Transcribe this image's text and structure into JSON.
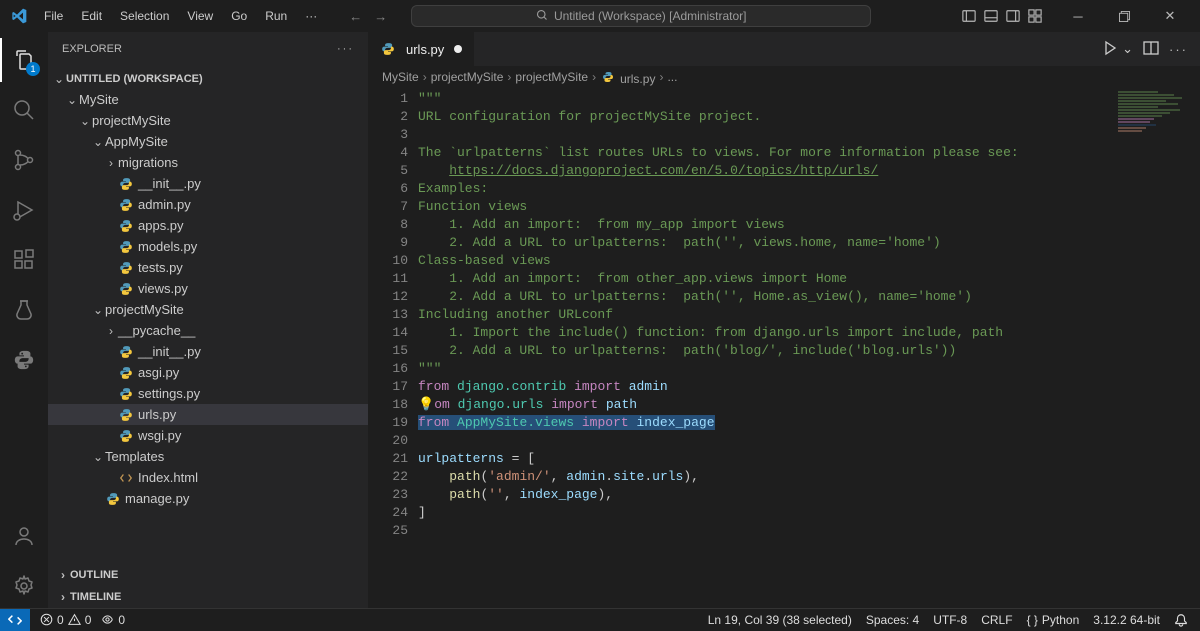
{
  "titlebar": {
    "menu": [
      "File",
      "Edit",
      "Selection",
      "View",
      "Go",
      "Run",
      "···"
    ],
    "search_placeholder": "Untitled (Workspace) [Administrator]"
  },
  "activity": {
    "explorer_badge": "1"
  },
  "sidebar": {
    "title": "EXPLORER",
    "workspace_label": "UNTITLED (WORKSPACE)",
    "outline_label": "OUTLINE",
    "timeline_label": "TIMELINE",
    "tree": [
      {
        "depth": 1,
        "twist": "v",
        "label": "MySite",
        "type": "folder"
      },
      {
        "depth": 2,
        "twist": "v",
        "label": "projectMySite",
        "type": "folder"
      },
      {
        "depth": 3,
        "twist": "v",
        "label": "AppMySite",
        "type": "folder"
      },
      {
        "depth": 4,
        "twist": ">",
        "label": "migrations",
        "type": "folder"
      },
      {
        "depth": 4,
        "icon": "py",
        "label": "__init__.py"
      },
      {
        "depth": 4,
        "icon": "py",
        "label": "admin.py"
      },
      {
        "depth": 4,
        "icon": "py",
        "label": "apps.py"
      },
      {
        "depth": 4,
        "icon": "py",
        "label": "models.py"
      },
      {
        "depth": 4,
        "icon": "py",
        "label": "tests.py"
      },
      {
        "depth": 4,
        "icon": "py",
        "label": "views.py"
      },
      {
        "depth": 3,
        "twist": "v",
        "label": "projectMySite",
        "type": "folder"
      },
      {
        "depth": 4,
        "twist": ">",
        "label": "__pycache__",
        "type": "folder"
      },
      {
        "depth": 4,
        "icon": "py",
        "label": "__init__.py"
      },
      {
        "depth": 4,
        "icon": "py",
        "label": "asgi.py"
      },
      {
        "depth": 4,
        "icon": "py",
        "label": "settings.py"
      },
      {
        "depth": 4,
        "icon": "py",
        "label": "urls.py",
        "selected": true
      },
      {
        "depth": 4,
        "icon": "py",
        "label": "wsgi.py"
      },
      {
        "depth": 3,
        "twist": "v",
        "label": "Templates",
        "type": "folder"
      },
      {
        "depth": 4,
        "icon": "html",
        "label": "Index.html"
      },
      {
        "depth": 3,
        "icon": "py",
        "label": "manage.py"
      }
    ]
  },
  "tab": {
    "filename": "urls.py",
    "modified": true
  },
  "breadcrumbs": [
    "MySite",
    "projectMySite",
    "projectMySite",
    "urls.py",
    "..."
  ],
  "editor": {
    "lines": [
      {
        "n": 1,
        "html": "<span class='c-comment'>\"\"\"</span>"
      },
      {
        "n": 2,
        "html": "<span class='c-comment'>URL configuration for projectMySite project.</span>"
      },
      {
        "n": 3,
        "html": ""
      },
      {
        "n": 4,
        "html": "<span class='c-comment'>The `urlpatterns` list routes URLs to views. For more information please see:</span>"
      },
      {
        "n": 5,
        "html": "<span class='c-comment'>    </span><span class='c-url'>https://docs.djangoproject.com/en/5.0/topics/http/urls/</span>"
      },
      {
        "n": 6,
        "html": "<span class='c-comment'>Examples:</span>"
      },
      {
        "n": 7,
        "html": "<span class='c-comment'>Function views</span>"
      },
      {
        "n": 8,
        "html": "<span class='c-comment'>    1. Add an import:  from my_app import views</span>"
      },
      {
        "n": 9,
        "html": "<span class='c-comment'>    2. Add a URL to urlpatterns:  path('', views.home, name='home')</span>"
      },
      {
        "n": 10,
        "html": "<span class='c-comment'>Class-based views</span>"
      },
      {
        "n": 11,
        "html": "<span class='c-comment'>    1. Add an import:  from other_app.views import Home</span>"
      },
      {
        "n": 12,
        "html": "<span class='c-comment'>    2. Add a URL to urlpatterns:  path('', Home.as_view(), name='home')</span>"
      },
      {
        "n": 13,
        "html": "<span class='c-comment'>Including another URLconf</span>"
      },
      {
        "n": 14,
        "html": "<span class='c-comment'>    1. Import the include() function: from django.urls import include, path</span>"
      },
      {
        "n": 15,
        "html": "<span class='c-comment'>    2. Add a URL to urlpatterns:  path('blog/', include('blog.urls'))</span>"
      },
      {
        "n": 16,
        "html": "<span class='c-comment'>\"\"\"</span>"
      },
      {
        "n": 17,
        "html": "<span class='c-keyword'>from</span> <span class='c-module'>django.contrib</span> <span class='c-keyword'>import</span> <span class='c-var'>admin</span>"
      },
      {
        "n": 18,
        "html": "<span class='bulb'>💡</span><span class='c-keyword'>om</span> <span class='c-module'>django.urls</span> <span class='c-keyword'>import</span> <span class='c-var'>path</span>"
      },
      {
        "n": 19,
        "html": "<span class='selected-code'><span class='c-keyword'>from</span> <span class='c-module'>AppMySite.views</span> <span class='c-keyword'>import</span> <span class='c-var'>index_page</span></span>"
      },
      {
        "n": 20,
        "html": ""
      },
      {
        "n": 21,
        "html": "<span class='c-var'>urlpatterns</span> = ["
      },
      {
        "n": 22,
        "html": "    <span class='c-func'>path</span>(<span class='c-string'>'admin/'</span>, <span class='c-var'>admin</span>.<span class='c-var'>site</span>.<span class='c-var'>urls</span>),"
      },
      {
        "n": 23,
        "html": "    <span class='c-func'>path</span>(<span class='c-string'>''</span>, <span class='c-var'>index_page</span>),"
      },
      {
        "n": 24,
        "html": "]"
      },
      {
        "n": 25,
        "html": ""
      }
    ]
  },
  "statusbar": {
    "errors": "0",
    "warnings": "0",
    "ports": "0",
    "cursor": "Ln 19, Col 39 (38 selected)",
    "spaces": "Spaces: 4",
    "encoding": "UTF-8",
    "eol": "CRLF",
    "language": "Python",
    "interpreter": "3.12.2 64-bit"
  }
}
